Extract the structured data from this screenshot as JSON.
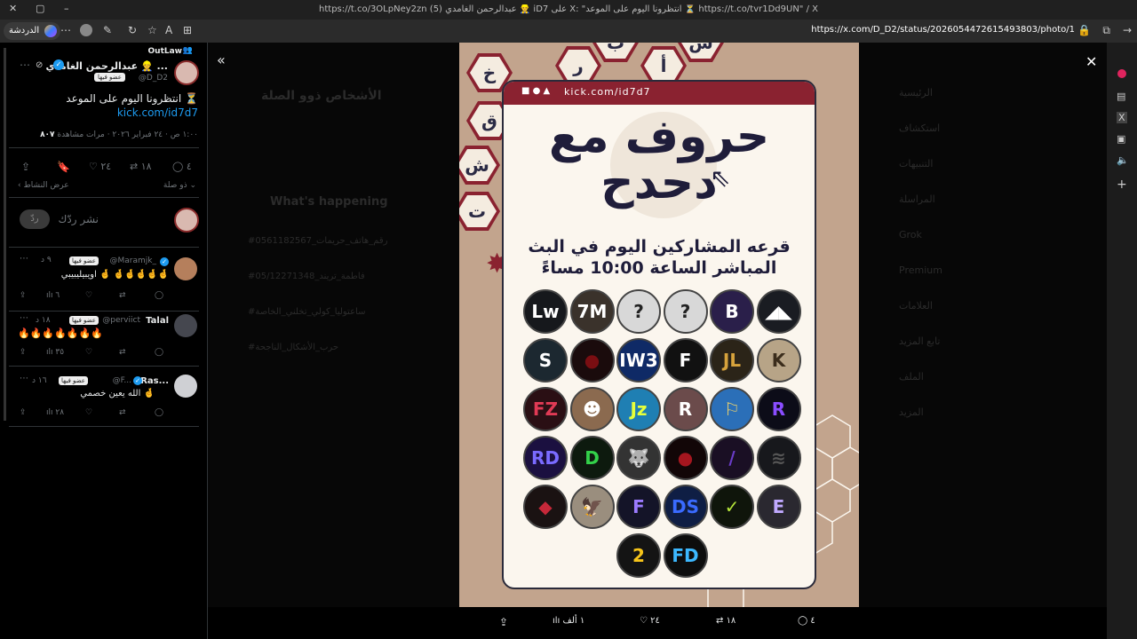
{
  "browser": {
    "window_title": "(5) عبدالرحمن الغامدي 👷‍♂️ iD7 على X: \"انتظرونا اليوم على الموعد ⏳ https://t.co/tvr1Dd9UN\" / X",
    "window_title_link": "https://t.co/3OLpNey2zn",
    "tab_label": "الدردشة",
    "url": "https://x.com/D_D2/status/2026054472615493803/photo/1"
  },
  "tweet": {
    "community": "OutLaw",
    "author_name": "عبدالرحمن الغامدي 👷‍♂️ ...",
    "author_handle": "@D_D2",
    "member_badge": "عضو فيها",
    "text": "انتظرونا اليوم على الموعد ⏳",
    "link": "kick.com/id7d7",
    "meta_time": "١:٠٠ ص · ٢٤ فبراير ٢٠٢٦ · ",
    "meta_views": "٨٠٧",
    "meta_views_label": " مرات مشاهدة",
    "likes": "٢٤",
    "retweets": "١٨",
    "replies": "٤",
    "activity_label": "عرض النشاط",
    "related_label": "ذو صلة",
    "reply_placeholder": "نشر ردّك",
    "reply_button": "ردّ"
  },
  "replies": [
    {
      "name": "",
      "handle": "@Maramjk_",
      "badge": "عضو فيها",
      "time": "٩ د",
      "text": "اويبيليبيبي 🤞 🤞🤞🤞🤞🤞",
      "views": "٦",
      "avatar": "#b57f5c"
    },
    {
      "name": "Talal",
      "handle": "@perviict",
      "badge": "عضو فيها",
      "time": "١٨ د",
      "text": "🔥🔥🔥🔥🔥🔥🔥",
      "views": "٣٥",
      "avatar": "#45474f"
    },
    {
      "name": "Ras...",
      "handle": "@F...",
      "badge": "عضو فيها",
      "time": "١٦ د",
      "text": "الله يعين خصمي 🤞",
      "views": "٢٨",
      "avatar": "#cfd0d4"
    }
  ],
  "poster": {
    "bar_url": "kick.com/id7d7",
    "title_line1": "حروف مع",
    "title_line2": "دحدح",
    "subtitle_line1": "قرعه المشاركين اليوم في البث",
    "subtitle_line2": "المباشر الساعة 10:00 مساءً",
    "letters": [
      "خ",
      "ر",
      "ب",
      "أ",
      "ش",
      "ق",
      "ش",
      "ت"
    ],
    "logos": [
      {
        "t": "Lw",
        "bg": "#16181c"
      },
      {
        "t": "7M",
        "bg": "#3a322b"
      },
      {
        "t": "?",
        "bg": "#d8d8d8",
        "fg": "#222"
      },
      {
        "t": "?",
        "bg": "#d8d8d8",
        "fg": "#222"
      },
      {
        "t": "B",
        "bg": "#2a1f4a"
      },
      {
        "t": "◢◣",
        "bg": "#1a1c22"
      },
      {
        "t": "S",
        "bg": "#1c2830"
      },
      {
        "t": "●",
        "bg": "#1a0b0c",
        "fg": "#7a0e12"
      },
      {
        "t": "IW3",
        "bg": "#0f2a66"
      },
      {
        "t": "F",
        "bg": "#111111"
      },
      {
        "t": "JL",
        "bg": "#2b2418",
        "fg": "#d6a23c"
      },
      {
        "t": "K",
        "bg": "#b7a487",
        "fg": "#3b2d1c"
      },
      {
        "t": "FZ",
        "bg": "#2a0f14",
        "fg": "#e03a55"
      },
      {
        "t": "☻",
        "bg": "#8b6a4f"
      },
      {
        "t": "Jz",
        "bg": "#1f7fb3",
        "fg": "#e6ff3a"
      },
      {
        "t": "R",
        "bg": "#6b4b4b"
      },
      {
        "t": "⚐",
        "bg": "#2b6fb8",
        "fg": "#f0d36a"
      },
      {
        "t": "R",
        "bg": "#0c0c18",
        "fg": "#8a4dff"
      },
      {
        "t": "RD",
        "bg": "#1b1040",
        "fg": "#7a6bff"
      },
      {
        "t": "D",
        "bg": "#0d1a0e",
        "fg": "#33d14a"
      },
      {
        "t": "🐺",
        "bg": "#333333"
      },
      {
        "t": "●",
        "bg": "#120607",
        "fg": "#a5161f"
      },
      {
        "t": "/",
        "bg": "#1a0f24",
        "fg": "#6a3cc8"
      },
      {
        "t": "≋",
        "bg": "#17181c",
        "fg": "#555"
      },
      {
        "t": "◆",
        "bg": "#1a1212",
        "fg": "#c62839"
      },
      {
        "t": "🦅",
        "bg": "#9a8e7e"
      },
      {
        "t": "F",
        "bg": "#141428",
        "fg": "#9b7bff"
      },
      {
        "t": "DS",
        "bg": "#0f1e44",
        "fg": "#3a6bff"
      },
      {
        "t": "✓",
        "bg": "#0f150b",
        "fg": "#b5e53a"
      },
      {
        "t": "E",
        "bg": "#2a2830",
        "fg": "#c0a9ff"
      },
      {
        "t": "2",
        "bg": "#141414",
        "fg": "#f7c51a"
      },
      {
        "t": "FD",
        "bg": "#0d0d0d",
        "fg": "#3cb8ff"
      }
    ]
  },
  "background_page": {
    "heading": "الأشخاص ذوو الصلة",
    "happening": "What's happening",
    "trends": [
      "#رقم_هاتف_حريمات_0561182567",
      "#فاطمة_تريند_05/12271348",
      "#ساعتوليا_كولي_تخلني_الخاصة",
      "#حرب_الأشكال_الناجحة"
    ],
    "nav": [
      "الرئيسية",
      "استكشاف",
      "التنبيهات",
      "المراسلة",
      "Grok",
      "Premium",
      "العلامات",
      "تابع المزيد",
      "الملف",
      "المزيد"
    ]
  },
  "bottom_actions": {
    "views": "١ ألف",
    "likes": "٢٤",
    "retweets": "١٨",
    "replies": "٤"
  }
}
